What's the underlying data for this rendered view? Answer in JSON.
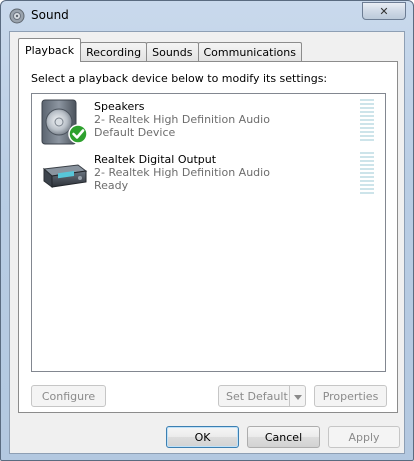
{
  "window": {
    "title": "Sound",
    "close_glyph": "✕"
  },
  "tabs": [
    {
      "label": "Playback",
      "active": true
    },
    {
      "label": "Recording",
      "active": false
    },
    {
      "label": "Sounds",
      "active": false
    },
    {
      "label": "Communications",
      "active": false
    }
  ],
  "playback": {
    "instruction": "Select a playback device below to modify its settings:",
    "devices": [
      {
        "name": "Speakers",
        "description": "2- Realtek High Definition Audio",
        "status": "Default Device",
        "icon": "speaker-icon",
        "is_default": true,
        "level": 0
      },
      {
        "name": "Realtek Digital Output",
        "description": "2- Realtek High Definition Audio",
        "status": "Ready",
        "icon": "digital-output-icon",
        "is_default": false,
        "level": 0
      }
    ],
    "buttons": {
      "configure": "Configure",
      "set_default": "Set Default",
      "properties": "Properties"
    }
  },
  "dialog_buttons": {
    "ok": "OK",
    "cancel": "Cancel",
    "apply": "Apply"
  },
  "colors": {
    "meter_bar": "#cde4ea",
    "default_check": "#2ea12e"
  }
}
